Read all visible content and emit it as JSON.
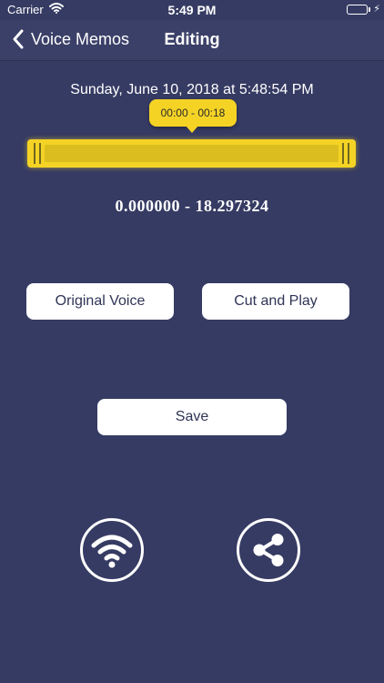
{
  "status_bar": {
    "carrier": "Carrier",
    "time": "5:49 PM",
    "battery_color": "#4cd964"
  },
  "nav": {
    "back_label": "Voice Memos",
    "title": "Editing"
  },
  "recording": {
    "date": "Sunday, June 10, 2018 at 5:48:54 PM"
  },
  "trimmer": {
    "tooltip": "00:00 - 00:18",
    "range_text": "0.000000 - 18.297324",
    "accent_color": "#f4d325"
  },
  "buttons": {
    "original_voice": "Original Voice",
    "cut_and_play": "Cut and Play",
    "save": "Save"
  },
  "icons": {
    "wifi": "wifi-icon",
    "share": "share-icon"
  },
  "colors": {
    "background": "#363b63",
    "button_text": "#2f3456"
  }
}
